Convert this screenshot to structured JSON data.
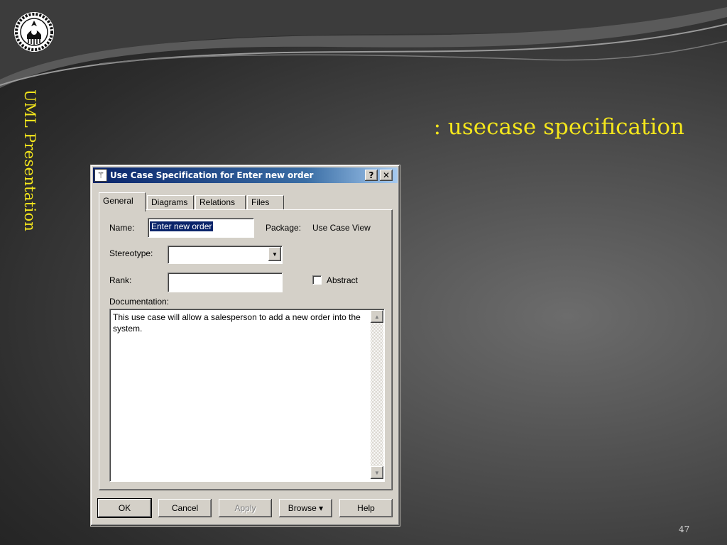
{
  "slide": {
    "side_title": "UML Presentation",
    "heading": ":  usecase specification",
    "page_number": "47"
  },
  "dialog": {
    "title": "Use Case Specification for Enter new order",
    "title_icon": "wand-icon",
    "titlebar_buttons": {
      "help": "?",
      "close": "✕"
    },
    "tabs": [
      {
        "label": "General",
        "active": true
      },
      {
        "label": "Diagrams"
      },
      {
        "label": "Relations"
      },
      {
        "label": "Files"
      }
    ],
    "fields": {
      "name_label": "Name:",
      "name_value": "Enter new order",
      "package_label": "Package:",
      "package_value": "Use Case View",
      "stereotype_label": "Stereotype:",
      "stereotype_value": "",
      "rank_label": "Rank:",
      "rank_value": "",
      "abstract_label": "Abstract",
      "abstract_checked": false,
      "documentation_label": "Documentation:",
      "documentation_value": "This use case will allow a salesperson to add a new order into the system."
    },
    "buttons": {
      "ok": "OK",
      "cancel": "Cancel",
      "apply": "Apply",
      "browse": "Browse",
      "help": "Help"
    }
  },
  "colors": {
    "accent_text": "#f4e61c",
    "titlebar_start": "#0a246a",
    "titlebar_end": "#a6caf0",
    "dialog_face": "#d4d0c8"
  }
}
